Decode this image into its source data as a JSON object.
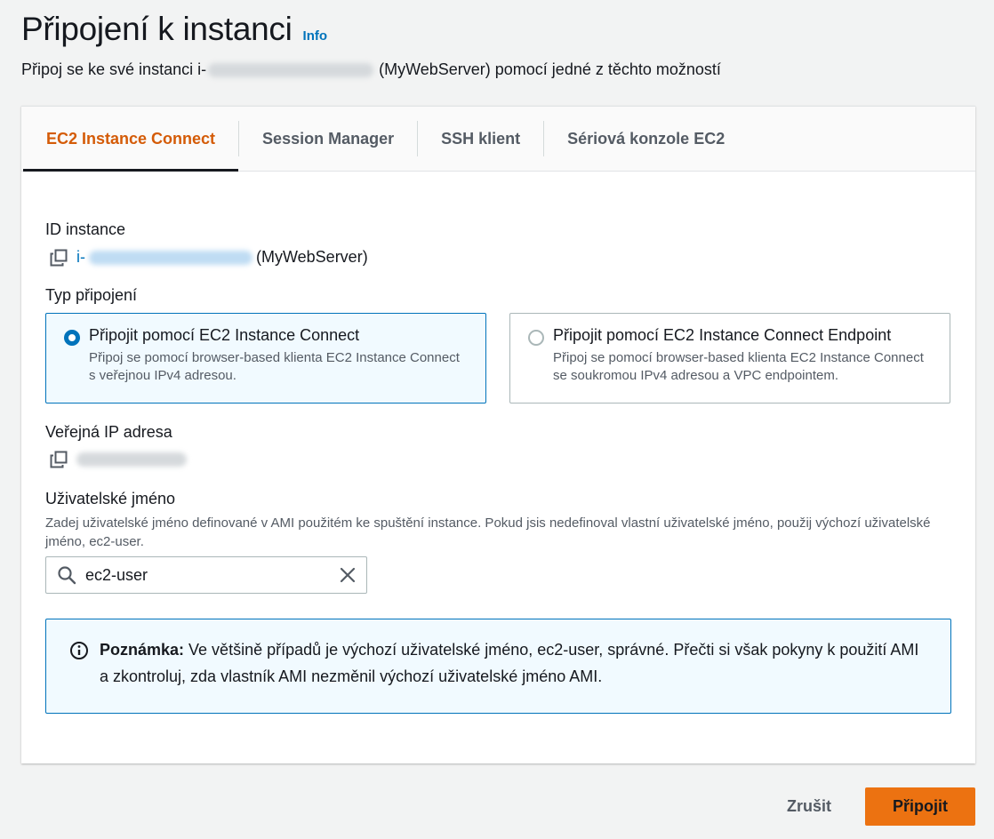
{
  "header": {
    "title": "Připojení k instanci",
    "info_label": "Info",
    "subtitle_prefix": "Připoj se ke své instanci i-",
    "subtitle_suffix": "(MyWebServer) pomocí jedné z těchto možností"
  },
  "tabs": [
    {
      "label": "EC2 Instance Connect",
      "active": true
    },
    {
      "label": "Session Manager",
      "active": false
    },
    {
      "label": "SSH klient",
      "active": false
    },
    {
      "label": "Sériová konzole EC2",
      "active": false
    }
  ],
  "instance_id": {
    "label": "ID instance",
    "id_prefix": "i-",
    "name_suffix": "(MyWebServer)"
  },
  "connection_type": {
    "label": "Typ připojení",
    "options": [
      {
        "title": "Připojit pomocí EC2 Instance Connect",
        "description": "Připoj se pomocí browser-based klienta EC2 Instance Connect s veřejnou IPv4 adresou.",
        "selected": true
      },
      {
        "title": "Připojit pomocí EC2 Instance Connect Endpoint",
        "description": "Připoj se pomocí browser-based klienta EC2 Instance Connect se soukromou IPv4 adresou a VPC endpointem.",
        "selected": false
      }
    ]
  },
  "public_ip": {
    "label": "Veřejná IP adresa"
  },
  "username": {
    "label": "Uživatelské jméno",
    "description": "Zadej uživatelské jméno definované v AMI použitém ke spuštění instance. Pokud jsis nedefinoval vlastní uživatelské jméno, použij výchozí uživatelské jméno, ec2-user.",
    "value": "ec2-user"
  },
  "alert": {
    "bold": "Poznámka:",
    "text": " Ve většině případů je výchozí uživatelské jméno, ec2-user, správné. Přečti si však pokyny k použití AMI a zkontroluj, zda vlastník AMI nezměnil výchozí uživatelské jméno AMI."
  },
  "footer": {
    "cancel_label": "Zrušit",
    "connect_label": "Připojit"
  },
  "colors": {
    "accent": "#0073bb",
    "primary_button": "#ec7211",
    "active_tab": "#d45b07"
  }
}
